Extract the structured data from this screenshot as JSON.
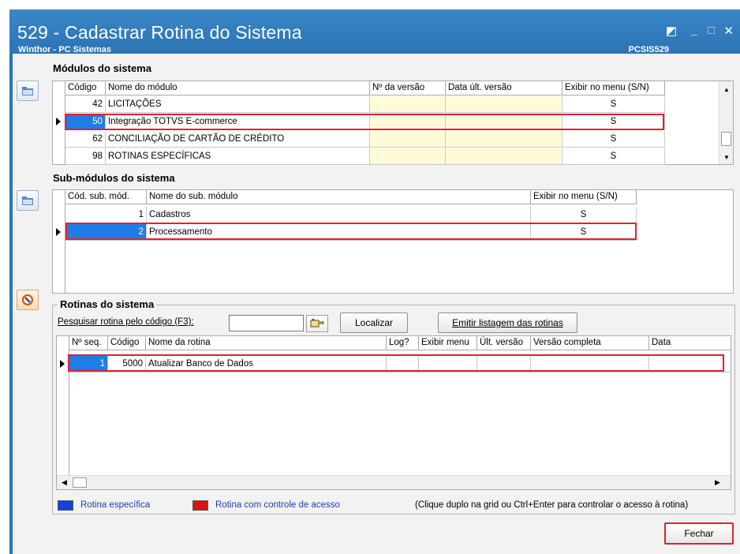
{
  "window": {
    "title": "529 - Cadastrar Rotina do Sistema",
    "subtitle": "Winthor - PC Sistemas",
    "code": "PCSIS529"
  },
  "modulos": {
    "title": "Módulos do sistema",
    "columns": [
      "Código",
      "Nome do módulo",
      "Nº da versão",
      "Data últ. versão",
      "Exibir no menu (S/N)"
    ],
    "rows": [
      {
        "codigo": "42",
        "nome": "LICITAÇÕES",
        "versao": "",
        "data": "",
        "exibir": "S"
      },
      {
        "codigo": "50",
        "nome": "Integração TOTVS E-commerce",
        "versao": "",
        "data": "",
        "exibir": "S"
      },
      {
        "codigo": "62",
        "nome": "CONCILIAÇÃO DE CARTÃO DE CRÉDITO",
        "versao": "",
        "data": "",
        "exibir": "S"
      },
      {
        "codigo": "98",
        "nome": "ROTINAS ESPECÍFICAS",
        "versao": "",
        "data": "",
        "exibir": "S"
      }
    ]
  },
  "submodulos": {
    "title": "Sub-módulos do sistema",
    "columns": [
      "Cód. sub. mód.",
      "Nome do sub. módulo",
      "Exibir no menu (S/N)"
    ],
    "rows": [
      {
        "codigo": "1",
        "nome": "Cadastros",
        "exibir": "S"
      },
      {
        "codigo": "2",
        "nome": "Processamento",
        "exibir": "S"
      }
    ]
  },
  "rotinas": {
    "title": "Rotinas do sistema",
    "search_label": "Pesquisar rotina pelo código (F3):",
    "search_value": "",
    "localizar": "Localizar",
    "emitir": "Emitir listagem das rotinas",
    "columns": [
      "Nº seq.",
      "Código",
      "Nome da rotina",
      "Log?",
      "Exibir menu",
      "Últ. versão",
      "Versão completa",
      "Data"
    ],
    "rows": [
      {
        "seq": "1",
        "codigo": "5000",
        "nome": "Atualizar Banco de Dados",
        "log": "",
        "exibir": "",
        "ult": "",
        "completa": "",
        "data": ""
      }
    ]
  },
  "legend": {
    "especifica": "Rotina específica",
    "controle": "Rotina com controle de acesso",
    "hint": "(Clique duplo na grid ou Ctrl+Enter para controlar o acesso à rotina)",
    "especifica_color": "#1640e0",
    "controle_color": "#e01010"
  },
  "footer": {
    "fechar": "Fechar"
  },
  "colors": {
    "titlebar": "#2c74b4",
    "selection": "#1e7de6",
    "highlight": "#e0212e",
    "version_cells": "#fffbd9"
  }
}
